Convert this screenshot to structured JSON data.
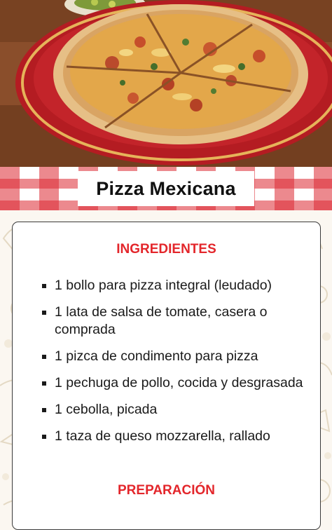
{
  "recipe": {
    "title": "Pizza Mexicana",
    "image_subject": "pizza-photo"
  },
  "sections": {
    "ingredients_heading": "INGREDIENTES",
    "preparation_heading": "PREPARACIÓN"
  },
  "ingredients": [
    "1 bollo para pizza integral (leudado)",
    "1 lata de salsa de tomate, casera o comprada",
    "1 pizca de condimento para pizza",
    "1 pechuga de pollo, cocida y desgrasada",
    "1 cebolla, picada",
    "1 taza de queso mozzarella, rallado"
  ],
  "colors": {
    "accent_red": "#e3262b",
    "gingham_red": "#dc2832",
    "title_text": "#111111",
    "body_text": "#1a1a1a"
  }
}
